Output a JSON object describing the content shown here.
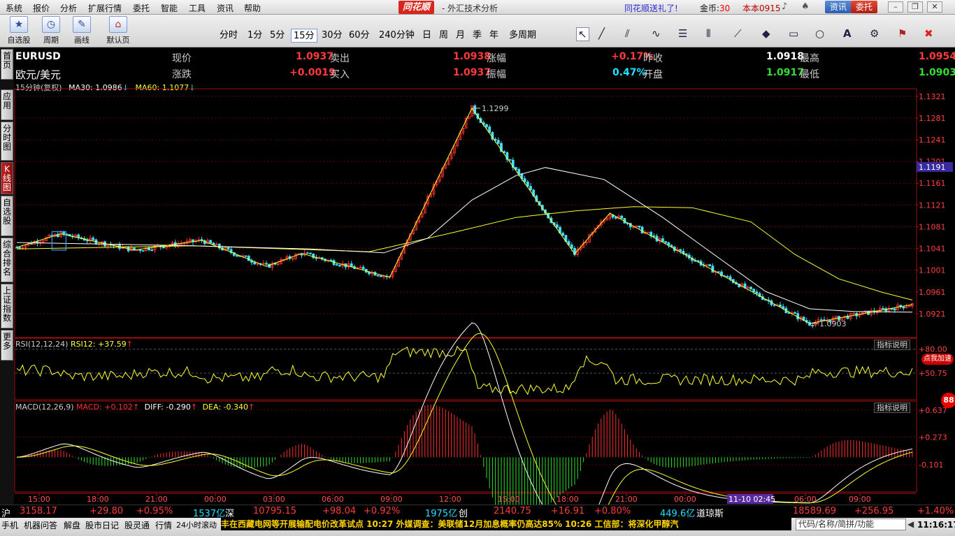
{
  "menu": {
    "items": [
      "系统",
      "报价",
      "分析",
      "扩展行情",
      "委托",
      "智能",
      "工具",
      "资讯",
      "帮助"
    ],
    "brand": "同花顺",
    "title": "- 外汇技术分析",
    "promo": "同花顺送礼了!",
    "coins_label": "金币:",
    "coins_value": "30",
    "account": "本本0915",
    "news_btn": "资讯",
    "trade_btn": "委托"
  },
  "toolbar": {
    "tools": [
      {
        "label": "自选股",
        "icon": "star-icon"
      },
      {
        "label": "周期",
        "icon": "clock-icon"
      },
      {
        "label": "画线",
        "icon": "pencil-icon"
      },
      {
        "label": "默认页",
        "icon": "home-icon"
      }
    ],
    "timeframes": [
      "分时",
      "1分",
      "5分",
      "15分",
      "30分",
      "60分",
      "240分钟",
      "日",
      "周",
      "月",
      "季",
      "年",
      "多周期"
    ],
    "active_timeframe": "15分",
    "draw_tools": [
      "cursor-icon",
      "line-icon",
      "parallel-icon",
      "wave-icon",
      "fibonacci-icon",
      "bars-icon",
      "channel-icon",
      "rect-icon",
      "circle-icon",
      "text-icon",
      "settings-icon",
      "mark-icon",
      "delete-icon"
    ]
  },
  "sidenav": [
    "首页",
    "应用",
    "分时图",
    "K线图",
    "自选股",
    "综合排名",
    "上证指数",
    "更多"
  ],
  "quote": {
    "symbol": "EURUSD",
    "name": "欧元/美元",
    "cells": [
      {
        "label": "现价",
        "value": "1.0937",
        "color": "red"
      },
      {
        "label": "卖出",
        "value": "1.0938",
        "color": "red"
      },
      {
        "label": "涨幅",
        "value": "+0.17%",
        "color": "red"
      },
      {
        "label": "昨收",
        "value": "1.0918",
        "color": "wht"
      },
      {
        "label": "最高",
        "value": "1.0954",
        "color": "red"
      },
      {
        "label": "涨跌",
        "value": "+0.0019",
        "color": "red"
      },
      {
        "label": "买入",
        "value": "1.0937",
        "color": "red"
      },
      {
        "label": "振幅",
        "value": "0.47%",
        "color": "cyn"
      },
      {
        "label": "开盘",
        "value": "1.0917",
        "color": "grn"
      },
      {
        "label": "最低",
        "value": "1.0903",
        "color": "grn"
      }
    ]
  },
  "ma_line": {
    "period": "15分钟(复权)",
    "ma30": "MA30: 1.0986",
    "ma60": "MA60: 1.1077"
  },
  "indicators": {
    "rsi": {
      "label": "RSI(12,12,24)",
      "value": "RSI12: +37.59",
      "help": "指标说明"
    },
    "macd": {
      "label": "MACD(12,26,9)",
      "macd": "MACD: +0.102",
      "diff": "DIFF: -0.290",
      "dea": "DEA: -0.340",
      "help": "指标说明"
    },
    "speed_badge": "点我加速",
    "counter_badge": "88"
  },
  "chart_data": {
    "type": "candlestick",
    "title": "",
    "price_axis": [
      "1.1321",
      "1.1281",
      "1.1241",
      "1.1201",
      "1.1161",
      "1.1121",
      "1.1081",
      "1.1041",
      "1.1001",
      "1.0961",
      "1.0921"
    ],
    "price_range": [
      1.0881,
      1.1331
    ],
    "current_price_tag": "1.1191",
    "current_price": 1.1191,
    "high_annotation": "1.1299",
    "high_value": 1.1299,
    "low_annotation": "1.0903",
    "low_value": 1.0903,
    "rsi_axis": [
      "+80.00",
      "+50.75"
    ],
    "macd_axis": [
      "+0.637",
      "+0.273",
      "-0.101"
    ],
    "time_axis": [
      "15:00",
      "18:00",
      "21:00",
      "00:00",
      "03:00",
      "06:00",
      "09:00",
      "12:00",
      "15:00",
      "18:00",
      "21:00",
      "00:00",
      "11-10 02:45",
      "06:00",
      "09:00"
    ],
    "highlight_time": "11-10 02:45",
    "zigzag": [
      [
        0,
        1.1043
      ],
      [
        15,
        1.1068
      ],
      [
        40,
        1.1038
      ],
      [
        63,
        1.1056
      ],
      [
        85,
        1.1008
      ],
      [
        97,
        1.1032
      ],
      [
        127,
        1.0988
      ],
      [
        155,
        1.1299
      ],
      [
        190,
        1.1031
      ],
      [
        202,
        1.1106
      ],
      [
        270,
        1.0903
      ],
      [
        305,
        1.0938
      ]
    ],
    "ma30": [
      [
        0,
        1.1052
      ],
      [
        60,
        1.1046
      ],
      [
        100,
        1.104
      ],
      [
        125,
        1.1033
      ],
      [
        140,
        1.106
      ],
      [
        155,
        1.113
      ],
      [
        170,
        1.1175
      ],
      [
        180,
        1.119
      ],
      [
        200,
        1.1168
      ],
      [
        220,
        1.1098
      ],
      [
        240,
        1.102
      ],
      [
        255,
        1.0962
      ],
      [
        270,
        1.093
      ],
      [
        285,
        1.0925
      ],
      [
        305,
        1.0924
      ]
    ],
    "ma60": [
      [
        0,
        1.104
      ],
      [
        60,
        1.1046
      ],
      [
        120,
        1.1035
      ],
      [
        150,
        1.1072
      ],
      [
        170,
        1.1098
      ],
      [
        190,
        1.111
      ],
      [
        210,
        1.1118
      ],
      [
        230,
        1.1116
      ],
      [
        250,
        1.109
      ],
      [
        265,
        1.103
      ],
      [
        280,
        1.0985
      ],
      [
        295,
        1.096
      ],
      [
        305,
        1.0946
      ]
    ]
  },
  "status": {
    "sh": {
      "name": "沪",
      "value": "3158.17",
      "change": "+29.80",
      "pct": "+0.95%",
      "amount": "1537亿"
    },
    "sz": {
      "name": "深",
      "value": "10795.15",
      "change": "+98.04",
      "pct": "+0.92%",
      "amount": "1975亿"
    },
    "cy": {
      "name": "创",
      "value": "2140.75",
      "change": "+16.91",
      "pct": "+0.80%",
      "amount": "449.6亿"
    },
    "dj": {
      "name": "道琼斯",
      "value": "18589.69",
      "change": "+256.95",
      "pct": "+1.40%"
    }
  },
  "bottom": {
    "tabs": [
      "手机",
      "机器问答",
      "解盘",
      "股市日记",
      "股灵通",
      "行情",
      "24小时滚动"
    ],
    "news": "丰在西藏电网等开展输配电价改革试点    10:27 外媒调查：美联储12月加息概率仍高达85%    10:26 工信部：将深化甲醇汽",
    "search_placeholder": "代码/名称/简拼/功能",
    "time": "11:16:17"
  }
}
